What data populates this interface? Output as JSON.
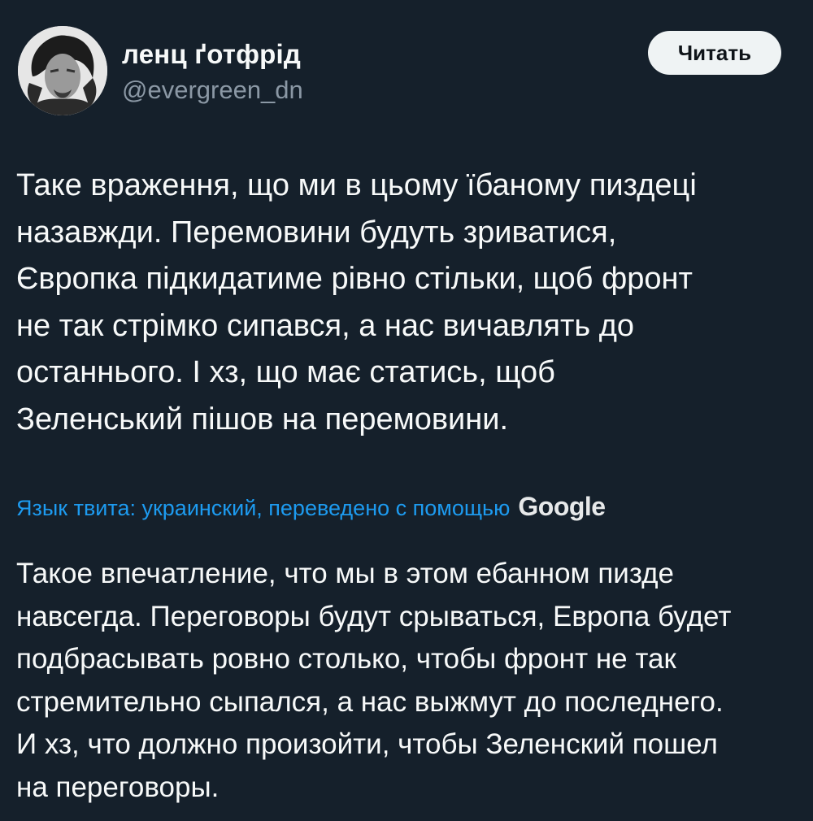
{
  "author": {
    "display_name": "ленц ґотфрід",
    "handle": "@evergreen_dn",
    "avatar_icon": "profile-photo"
  },
  "actions": {
    "follow_label": "Читать"
  },
  "tweet": {
    "text": "Таке враження, що ми в цьому їбаному пиздеці\nназавжди. Перемовини будуть зриватися,\nЄвропка підкидатиме рівно стільки, щоб фронт\nне так стрімко сипався, а нас вичавлять до\nостаннього. І хз, що має статись, щоб\nЗеленський пішов на перемовини."
  },
  "translation": {
    "note": "Язык твита: украинский, переведено с помощью",
    "provider": "Google",
    "text": "Такое впечатление, что мы в этом ебанном пизде\nнавсегда. Переговоры будут срываться, Европа будет\nподбрасывать ровно столько, чтобы фронт не так\nстремительно сыпался, а нас выжмут до последнего.\nИ хз, что должно произойти, чтобы Зеленский пошел\nна переговоры."
  },
  "colors": {
    "background": "#15202b",
    "primary_text": "#f7f9f9",
    "secondary_text": "#8b98a5",
    "link": "#1d9bf0",
    "button_bg": "#eff3f4"
  }
}
